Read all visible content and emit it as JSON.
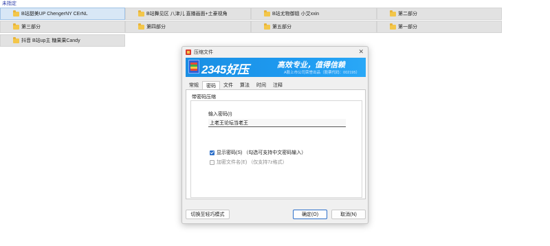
{
  "top_label": "未指定",
  "folders": [
    {
      "label": "B站甜美UP ChengerNY CErNL",
      "selected": true
    },
    {
      "label": "B站舞见区 八津儿 直播画面+土豪视角",
      "selected": false
    },
    {
      "label": "B站尤物御姐 小艾xxin",
      "selected": false
    },
    {
      "label": "第二部分",
      "selected": false
    },
    {
      "label": "第三部分",
      "selected": false
    },
    {
      "label": "第四部分",
      "selected": false
    },
    {
      "label": "第五部分",
      "selected": false
    },
    {
      "label": "第一部分",
      "selected": false
    },
    {
      "label": "抖音 B站up主 糖果果Candy",
      "selected": false
    }
  ],
  "dialog": {
    "title": "压缩文件",
    "close_icon": "close-icon",
    "banner": {
      "brand": "2345好压",
      "slogan": "高效专业，值得信赖",
      "subtext": "A股上市公司荣誉出品（股票代码：002195）"
    },
    "tabs": [
      {
        "label": "常规",
        "active": false
      },
      {
        "label": "密码",
        "active": true
      },
      {
        "label": "文件",
        "active": false
      },
      {
        "label": "算法",
        "active": false
      },
      {
        "label": "时间",
        "active": false
      },
      {
        "label": "注释",
        "active": false
      }
    ],
    "group_title": "带密码压缩",
    "password_label": "输入密码(I)",
    "password_value": "上老王论坛当老王",
    "show_password": {
      "label": "显示密码(S) （勾选可支持中文密码输入）",
      "checked": true
    },
    "encrypt_filenames": {
      "label": "加密文件名(E) （仅支持7z格式）",
      "checked": false,
      "disabled": true
    },
    "btn_simple_mode": "切换至轻巧模式",
    "btn_ok": "确定(O)",
    "btn_cancel": "取消(N)"
  },
  "colors": {
    "banner_blue": "#1e9af0",
    "accent_blue": "#2c6fc9",
    "folder_yellow": "#f3c64a"
  }
}
